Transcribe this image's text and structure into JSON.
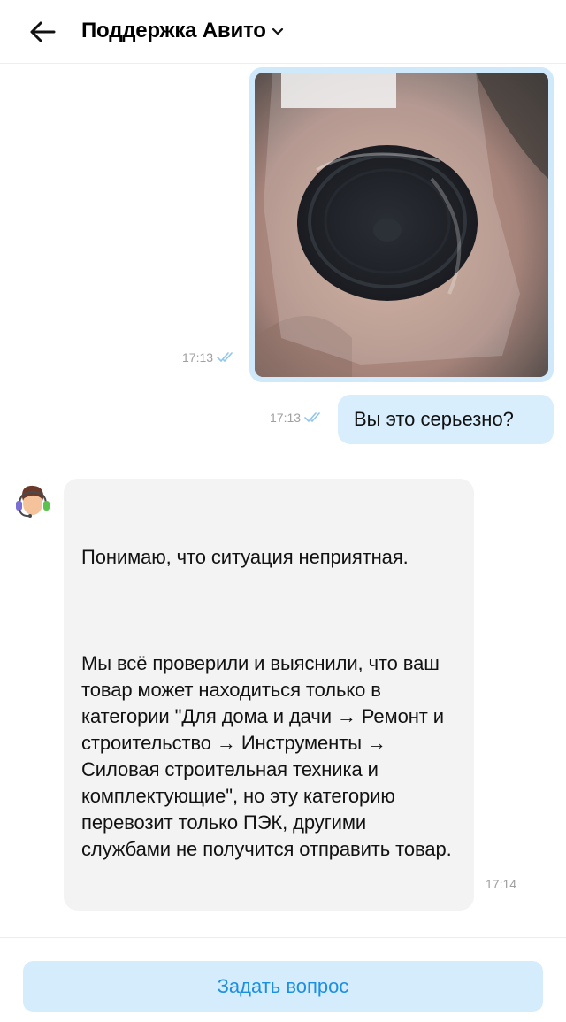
{
  "header": {
    "title": "Поддержка Авито",
    "back_icon": "arrow-left-icon",
    "dropdown_icon": "chevron-down-icon"
  },
  "messages": {
    "photo": {
      "time": "17:13",
      "status_icon": "double-check-icon"
    },
    "outgoing_text": {
      "text": "Вы это серьезно?",
      "time": "17:13",
      "status_icon": "double-check-icon"
    },
    "incoming": {
      "avatar_icon": "support-agent-avatar-icon",
      "paragraph1": "Понимаю, что ситуация неприятная.",
      "paragraph2": "Мы всё проверили и выяснили, что ваш товар может находиться только в категории \"Для дома и дачи → Ремонт и строительство → Инструменты → Силовая строительная техника и комплектующие\", но эту категорию перевозит только ПЭК, другими службами не получится отправить товар.",
      "time": "17:14"
    }
  },
  "footer": {
    "ask_button_label": "Задать вопрос"
  },
  "colors": {
    "outgoing_bubble": "#d8eefd",
    "incoming_bubble": "#f3f3f3",
    "button_bg": "#d5ecfd",
    "button_text": "#1b8fe0",
    "check_color": "#8fc6ee"
  }
}
